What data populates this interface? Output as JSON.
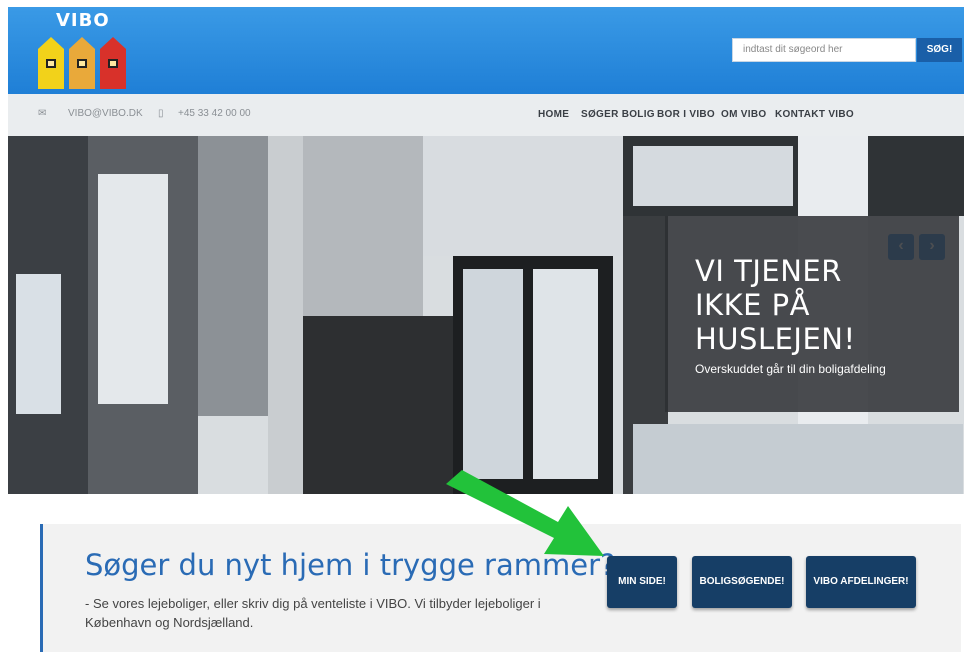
{
  "header": {
    "logo_text": "VIBO",
    "search": {
      "placeholder": "indtast dit søgeord her",
      "button_label": "SØG!"
    }
  },
  "topbar": {
    "email": "VIBO@VIBO.DK",
    "phone": "+45 33 42 00 00",
    "nav": [
      "HOME",
      "SØGER BOLIG",
      "BOR I VIBO",
      "OM VIBO",
      "KONTAKT VIBO"
    ]
  },
  "slide": {
    "title": "VI TJENER\nIKKE PÅ\nHUSLEJEN!",
    "subtitle": "Overskuddet går til din boligafdeling",
    "prev_label": "‹",
    "next_label": "›"
  },
  "callout": {
    "title": "Søger du nyt hjem i trygge rammer?",
    "text": "- Se vores lejeboliger, eller skriv dig på venteliste i VIBO. Vi tilbyder lejeboliger i København og Nordsjælland.",
    "buttons": [
      "MIN SIDE!",
      "BOLIGSØGENDE!",
      "VIBO AFDELINGER!"
    ]
  },
  "colors": {
    "header_blue": "#1f7fd6",
    "cta_navy": "#163e66",
    "arrow_green": "#22c23a",
    "house_colors": [
      "#f2d21a",
      "#e9a93a",
      "#d8312a"
    ]
  }
}
